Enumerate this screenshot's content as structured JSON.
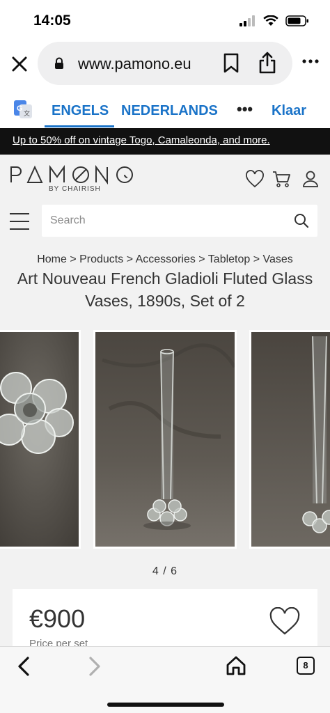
{
  "status_bar": {
    "time": "14:05"
  },
  "browser": {
    "url": "www.pamono.eu",
    "tab_count": "8"
  },
  "translate": {
    "lang_from": "ENGELS",
    "lang_to": "NEDERLANDS",
    "more": "•••",
    "done": "Klaar"
  },
  "promo": {
    "text": "Up to 50% off on vintage Togo, Camaleonda, and more."
  },
  "site": {
    "logo_sub": "BY CHAIRISH",
    "search_placeholder": "Search"
  },
  "breadcrumb": "Home > Products > Accessories > Tabletop > Vases",
  "product": {
    "title": "Art Nouveau French Gladioli Fluted Glass Vases, 1890s, Set of 2",
    "pager": "4 / 6",
    "price": "€900",
    "price_note": "Price per set"
  },
  "colors": {
    "link_blue": "#1a73c8",
    "promo_bg": "#111111",
    "page_bg": "#f2f2f2"
  }
}
